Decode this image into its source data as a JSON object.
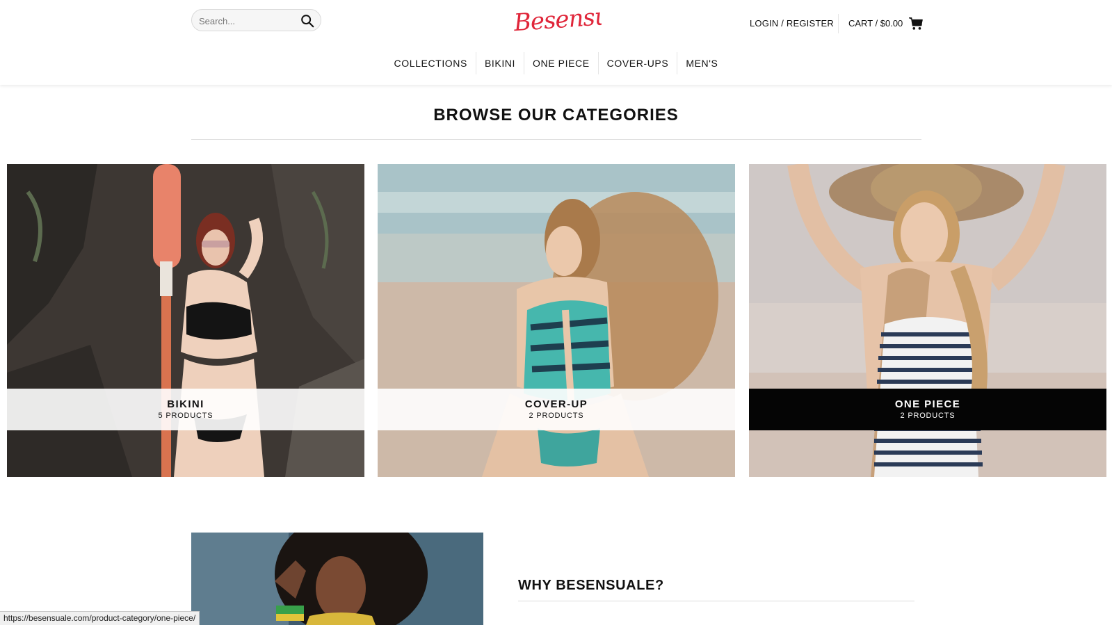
{
  "header": {
    "search_placeholder": "Search...",
    "logo_text": "Besensuale",
    "login_label": "LOGIN / REGISTER",
    "cart_label": "CART / $0.00"
  },
  "nav": {
    "items": [
      {
        "label": "COLLECTIONS"
      },
      {
        "label": "BIKINI"
      },
      {
        "label": "ONE PIECE"
      },
      {
        "label": "COVER-UPS"
      },
      {
        "label": "MEN'S"
      }
    ]
  },
  "categories": {
    "title": "BROWSE OUR CATEGORIES",
    "items": [
      {
        "name": "BIKINI",
        "count": "5 PRODUCTS"
      },
      {
        "name": "COVER-UP",
        "count": "2 PRODUCTS"
      },
      {
        "name": "ONE PIECE",
        "count": "2 PRODUCTS"
      }
    ]
  },
  "why": {
    "title": "WHY BESENSUALE?"
  },
  "status": {
    "url": "https://besensuale.com/product-category/one-piece/"
  },
  "colors": {
    "logo": "#e0263a",
    "dark_label": "#050505"
  }
}
